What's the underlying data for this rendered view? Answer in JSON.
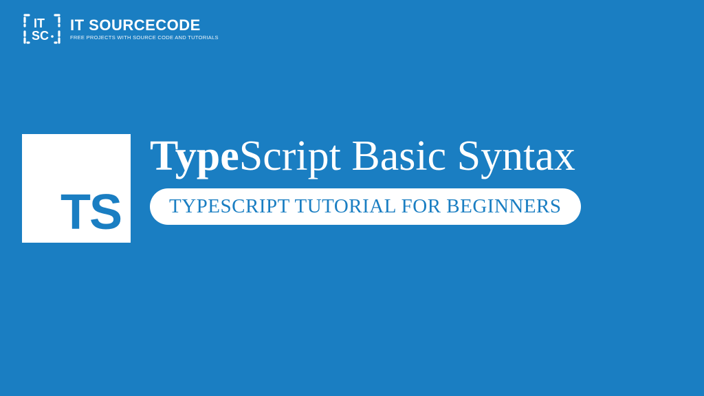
{
  "brand": {
    "name": "IT SOURCECODE",
    "tagline": "FREE PROJECTS WITH SOURCE CODE AND TUTORIALS"
  },
  "badge": {
    "text": "TS"
  },
  "title": {
    "bold_part": "Type",
    "rest": "Script Basic Syntax"
  },
  "subtitle": "TYPESCRIPT TUTORIAL FOR BEGINNERS",
  "colors": {
    "background": "#1a7ec2",
    "foreground": "#ffffff"
  }
}
